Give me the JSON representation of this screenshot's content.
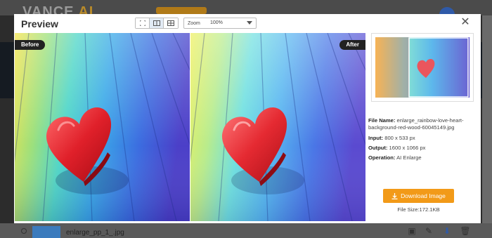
{
  "background": {
    "logo_text": "VANCE",
    "logo_ai": "AI",
    "file_name": "enlarge_pp_1_.jpg"
  },
  "modal": {
    "title": "Preview",
    "close_icon": "close-icon",
    "view_modes": [
      {
        "name": "fit-view-icon",
        "active": false
      },
      {
        "name": "split-view-icon",
        "active": true
      },
      {
        "name": "grid-view-icon",
        "active": false
      }
    ],
    "zoom": {
      "label": "Zoom",
      "value": "100%"
    },
    "before_label": "Before",
    "after_label": "After",
    "info": {
      "file_name_label": "File Name:",
      "file_name_value": "enlarge_rainbow-love-heart-background-red-wood-60045149.jpg",
      "input_label": "Input:",
      "input_value": "800 x 533 px",
      "output_label": "Output:",
      "output_value": "1600 x 1066 px",
      "operation_label": "Operation:",
      "operation_value": "AI Enlarge"
    },
    "download_label": "Download Image",
    "file_size": "File Size:172.1KB"
  },
  "colors": {
    "accent": "#f29a18",
    "tag_bg": "#222222"
  }
}
